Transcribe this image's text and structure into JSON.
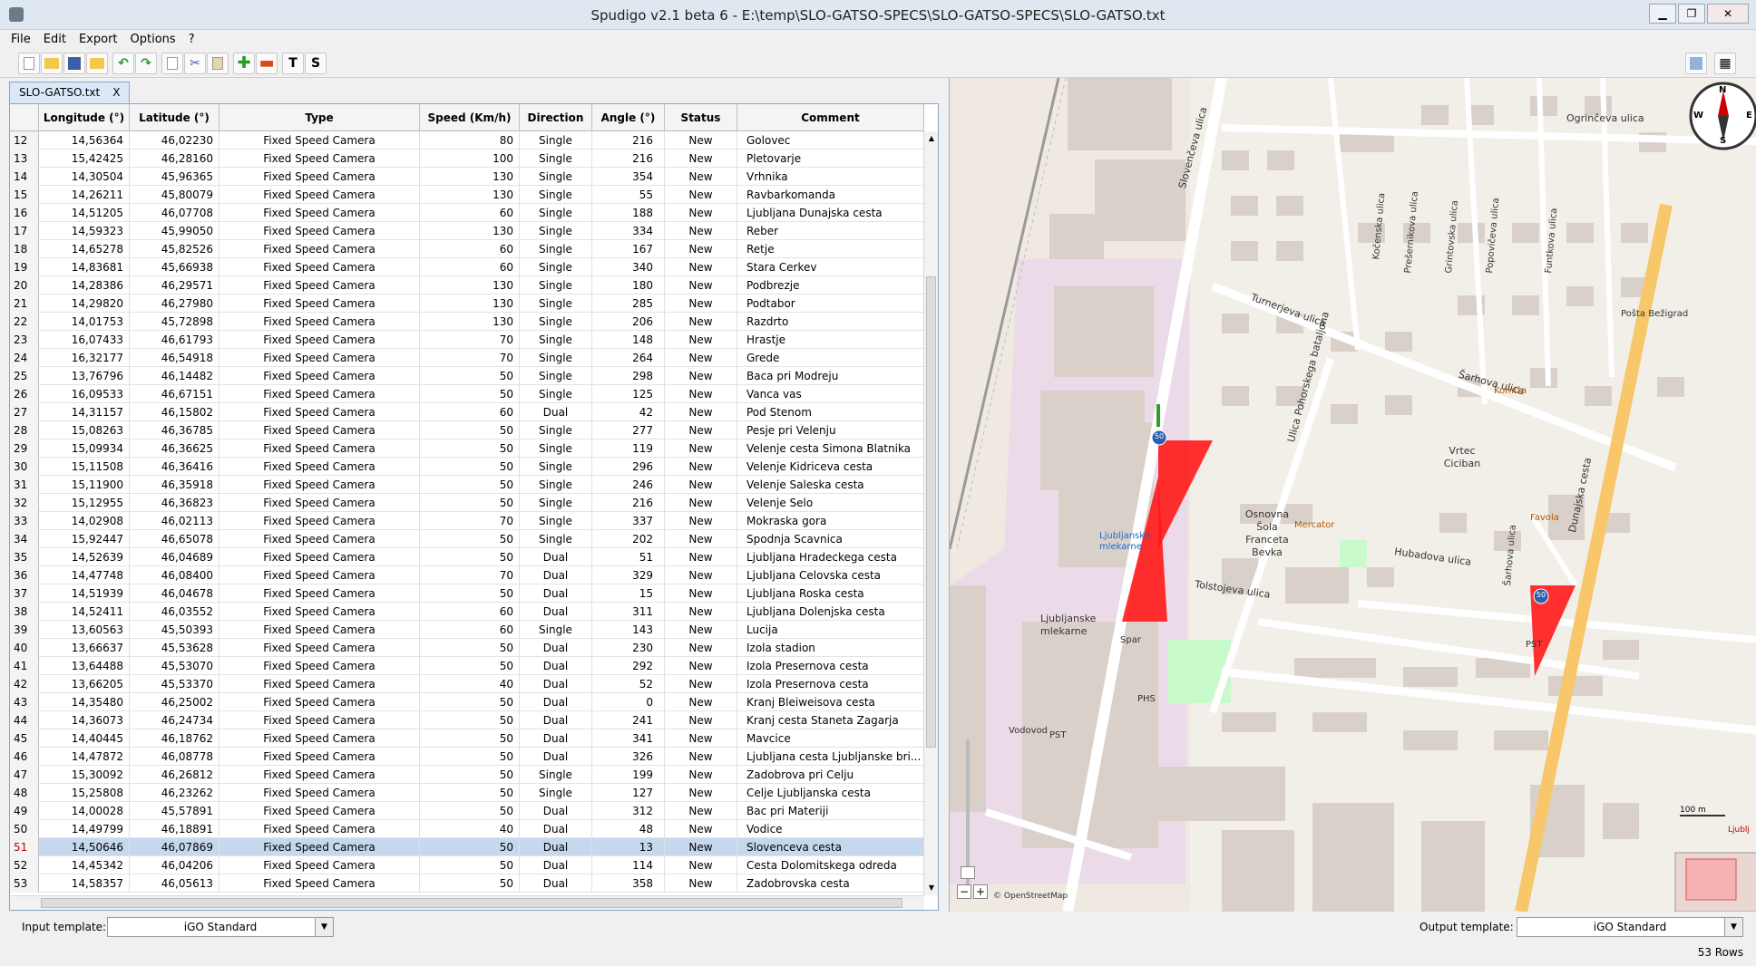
{
  "window": {
    "title": "Spudigo v2.1 beta 6 - E:\\temp\\SLO-GATSO-SPECS\\SLO-GATSO-SPECS\\SLO-GATSO.txt"
  },
  "menu": [
    "File",
    "Edit",
    "Export",
    "Options",
    "?"
  ],
  "toolbar": {
    "text_btn": "T",
    "s_btn": "S"
  },
  "tab": {
    "label": "SLO-GATSO.txt",
    "close": "X"
  },
  "table": {
    "columns": [
      "",
      "Longitude (°)",
      "Latitude (°)",
      "Type",
      "Speed (Km/h)",
      "Direction",
      "Angle (°)",
      "Status",
      "Comment"
    ],
    "selected_row": 51,
    "rows": [
      [
        "12",
        "14,56364",
        "46,02230",
        "Fixed Speed Camera",
        "80",
        "Single",
        "216",
        "New",
        "Golovec"
      ],
      [
        "13",
        "15,42425",
        "46,28160",
        "Fixed Speed Camera",
        "100",
        "Single",
        "216",
        "New",
        "Pletovarje"
      ],
      [
        "14",
        "14,30504",
        "45,96365",
        "Fixed Speed Camera",
        "130",
        "Single",
        "354",
        "New",
        "Vrhnika"
      ],
      [
        "15",
        "14,26211",
        "45,80079",
        "Fixed Speed Camera",
        "130",
        "Single",
        "55",
        "New",
        "Ravbarkomanda"
      ],
      [
        "16",
        "14,51205",
        "46,07708",
        "Fixed Speed Camera",
        "60",
        "Single",
        "188",
        "New",
        "Ljubljana Dunajska cesta"
      ],
      [
        "17",
        "14,59323",
        "45,99050",
        "Fixed Speed Camera",
        "130",
        "Single",
        "334",
        "New",
        "Reber"
      ],
      [
        "18",
        "14,65278",
        "45,82526",
        "Fixed Speed Camera",
        "60",
        "Single",
        "167",
        "New",
        "Retje"
      ],
      [
        "19",
        "14,83681",
        "45,66938",
        "Fixed Speed Camera",
        "60",
        "Single",
        "340",
        "New",
        "Stara Cerkev"
      ],
      [
        "20",
        "14,28386",
        "46,29571",
        "Fixed Speed Camera",
        "130",
        "Single",
        "180",
        "New",
        "Podbrezje"
      ],
      [
        "21",
        "14,29820",
        "46,27980",
        "Fixed Speed Camera",
        "130",
        "Single",
        "285",
        "New",
        "Podtabor"
      ],
      [
        "22",
        "14,01753",
        "45,72898",
        "Fixed Speed Camera",
        "130",
        "Single",
        "206",
        "New",
        "Razdrto"
      ],
      [
        "23",
        "16,07433",
        "46,61793",
        "Fixed Speed Camera",
        "70",
        "Single",
        "148",
        "New",
        "Hrastje"
      ],
      [
        "24",
        "16,32177",
        "46,54918",
        "Fixed Speed Camera",
        "70",
        "Single",
        "264",
        "New",
        "Grede"
      ],
      [
        "25",
        "13,76796",
        "46,14482",
        "Fixed Speed Camera",
        "50",
        "Single",
        "298",
        "New",
        "Baca pri Modreju"
      ],
      [
        "26",
        "16,09533",
        "46,67151",
        "Fixed Speed Camera",
        "50",
        "Single",
        "125",
        "New",
        "Vanca vas"
      ],
      [
        "27",
        "14,31157",
        "46,15802",
        "Fixed Speed Camera",
        "60",
        "Dual",
        "42",
        "New",
        "Pod Stenom"
      ],
      [
        "28",
        "15,08263",
        "46,36785",
        "Fixed Speed Camera",
        "50",
        "Single",
        "277",
        "New",
        "Pesje pri Velenju"
      ],
      [
        "29",
        "15,09934",
        "46,36625",
        "Fixed Speed Camera",
        "50",
        "Single",
        "119",
        "New",
        "Velenje cesta Simona Blatnika"
      ],
      [
        "30",
        "15,11508",
        "46,36416",
        "Fixed Speed Camera",
        "50",
        "Single",
        "296",
        "New",
        "Velenje Kidriceva cesta"
      ],
      [
        "31",
        "15,11900",
        "46,35918",
        "Fixed Speed Camera",
        "50",
        "Single",
        "246",
        "New",
        "Velenje Saleska cesta"
      ],
      [
        "32",
        "15,12955",
        "46,36823",
        "Fixed Speed Camera",
        "50",
        "Single",
        "216",
        "New",
        "Velenje Selo"
      ],
      [
        "33",
        "14,02908",
        "46,02113",
        "Fixed Speed Camera",
        "70",
        "Single",
        "337",
        "New",
        "Mokraska gora"
      ],
      [
        "34",
        "15,92447",
        "46,65078",
        "Fixed Speed Camera",
        "50",
        "Single",
        "202",
        "New",
        "Spodnja Scavnica"
      ],
      [
        "35",
        "14,52639",
        "46,04689",
        "Fixed Speed Camera",
        "50",
        "Dual",
        "51",
        "New",
        "Ljubljana Hradeckega cesta"
      ],
      [
        "36",
        "14,47748",
        "46,08400",
        "Fixed Speed Camera",
        "70",
        "Dual",
        "329",
        "New",
        "Ljubljana Celovska cesta"
      ],
      [
        "37",
        "14,51939",
        "46,04678",
        "Fixed Speed Camera",
        "50",
        "Dual",
        "15",
        "New",
        "Ljubljana Roska cesta"
      ],
      [
        "38",
        "14,52411",
        "46,03552",
        "Fixed Speed Camera",
        "60",
        "Dual",
        "311",
        "New",
        "Ljubljana Dolenjska cesta"
      ],
      [
        "39",
        "13,60563",
        "45,50393",
        "Fixed Speed Camera",
        "60",
        "Single",
        "143",
        "New",
        "Lucija"
      ],
      [
        "40",
        "13,66637",
        "45,53628",
        "Fixed Speed Camera",
        "50",
        "Dual",
        "230",
        "New",
        "Izola stadion"
      ],
      [
        "41",
        "13,64488",
        "45,53070",
        "Fixed Speed Camera",
        "50",
        "Dual",
        "292",
        "New",
        "Izola Presernova cesta"
      ],
      [
        "42",
        "13,66205",
        "45,53370",
        "Fixed Speed Camera",
        "40",
        "Dual",
        "52",
        "New",
        "Izola Presernova cesta"
      ],
      [
        "43",
        "14,35480",
        "46,25002",
        "Fixed Speed Camera",
        "50",
        "Dual",
        "0",
        "New",
        "Kranj Bleiweisova cesta"
      ],
      [
        "44",
        "14,36073",
        "46,24734",
        "Fixed Speed Camera",
        "50",
        "Dual",
        "241",
        "New",
        "Kranj cesta Staneta Zagarja"
      ],
      [
        "45",
        "14,40445",
        "46,18762",
        "Fixed Speed Camera",
        "50",
        "Dual",
        "341",
        "New",
        "Mavcice"
      ],
      [
        "46",
        "14,47872",
        "46,08778",
        "Fixed Speed Camera",
        "50",
        "Dual",
        "326",
        "New",
        "Ljubljana cesta Ljubljanske bri..."
      ],
      [
        "47",
        "15,30092",
        "46,26812",
        "Fixed Speed Camera",
        "50",
        "Single",
        "199",
        "New",
        "Zadobrova pri Celju"
      ],
      [
        "48",
        "15,25808",
        "46,23262",
        "Fixed Speed Camera",
        "50",
        "Single",
        "127",
        "New",
        "Celje Ljubljanska cesta"
      ],
      [
        "49",
        "14,00028",
        "45,57891",
        "Fixed Speed Camera",
        "50",
        "Dual",
        "312",
        "New",
        "Bac pri Materiji"
      ],
      [
        "50",
        "14,49799",
        "46,18891",
        "Fixed Speed Camera",
        "40",
        "Dual",
        "48",
        "New",
        "Vodice"
      ],
      [
        "51",
        "14,50646",
        "46,07869",
        "Fixed Speed Camera",
        "50",
        "Dual",
        "13",
        "New",
        "Slovenceva cesta"
      ],
      [
        "52",
        "14,45342",
        "46,04206",
        "Fixed Speed Camera",
        "50",
        "Dual",
        "114",
        "New",
        "Cesta Dolomitskega odreda"
      ],
      [
        "53",
        "14,58357",
        "46,05613",
        "Fixed Speed Camera",
        "50",
        "Dual",
        "358",
        "New",
        "Zadobrovska cesta"
      ]
    ]
  },
  "map": {
    "streets": {
      "slovenceva_ulica": "Slovenčeva ulica",
      "turnerjeva_ulica": "Turnerjeva ulica",
      "ulica_pohorskega_bataljona": "Ulica Pohorskega bataljona",
      "sarhova_ulica": "Šarhova ulica",
      "hubadova_ulica": "Hubadova ulica",
      "tolstojeva_ulica": "Tolstojeva ulica",
      "dunajska_cesta": "Dunajska cesta",
      "ogrinceva_ulica": "Ogrinčeva ulica",
      "funtkova_ulica": "Funtkova ulica",
      "popovičeva_ulica": "Popovičeva ulica",
      "grintovska_ulica": "Grintovska ulica",
      "presernikova_ulica": "Prešernikova ulica",
      "kocenska_ulica": "Kočenska ulica",
      "sarhova_ulica_v": "Šarhova ulica"
    },
    "pois": {
      "osnovna_sola": "Osnovna Šola Franceta Bevka",
      "mercator": "Mercator",
      "spar": "Spar",
      "ljubljanske_mlekarne": "Ljubljanske mlekarne",
      "ljubljanske_mlekarne_poi": "Ljubljanske mlekarne",
      "vrtec_ciciban": "Vrtec Ciciban",
      "posta": "Pošta Bežigrad",
      "komiza": "Komiža",
      "phs": "PHS",
      "pst": "PST",
      "pst2": "PST",
      "favola": "Favola",
      "vodovod": "Vodovod"
    },
    "camera_badges": [
      "50",
      "50"
    ],
    "scale": "100 m",
    "attribution": "© OpenStreetMap",
    "compass": {
      "n": "N",
      "e": "E",
      "s": "S",
      "w": "W"
    },
    "overview_label": "Ljublj",
    "zoom_minus": "−",
    "zoom_plus": "+",
    "colors": {
      "camera_cone": "#ff1a1a",
      "road_primary": "#f7c76a",
      "building": "#d9d0c9",
      "landuse_industrial": "#ebdbe8",
      "park": "#c8facc",
      "selection": "#c6d8ee"
    }
  },
  "bottom": {
    "input_label": "Input template:",
    "input_value": "iGO Standard",
    "output_label": "Output template:",
    "output_value": "iGO Standard"
  },
  "status": {
    "rows": "53 Rows"
  }
}
